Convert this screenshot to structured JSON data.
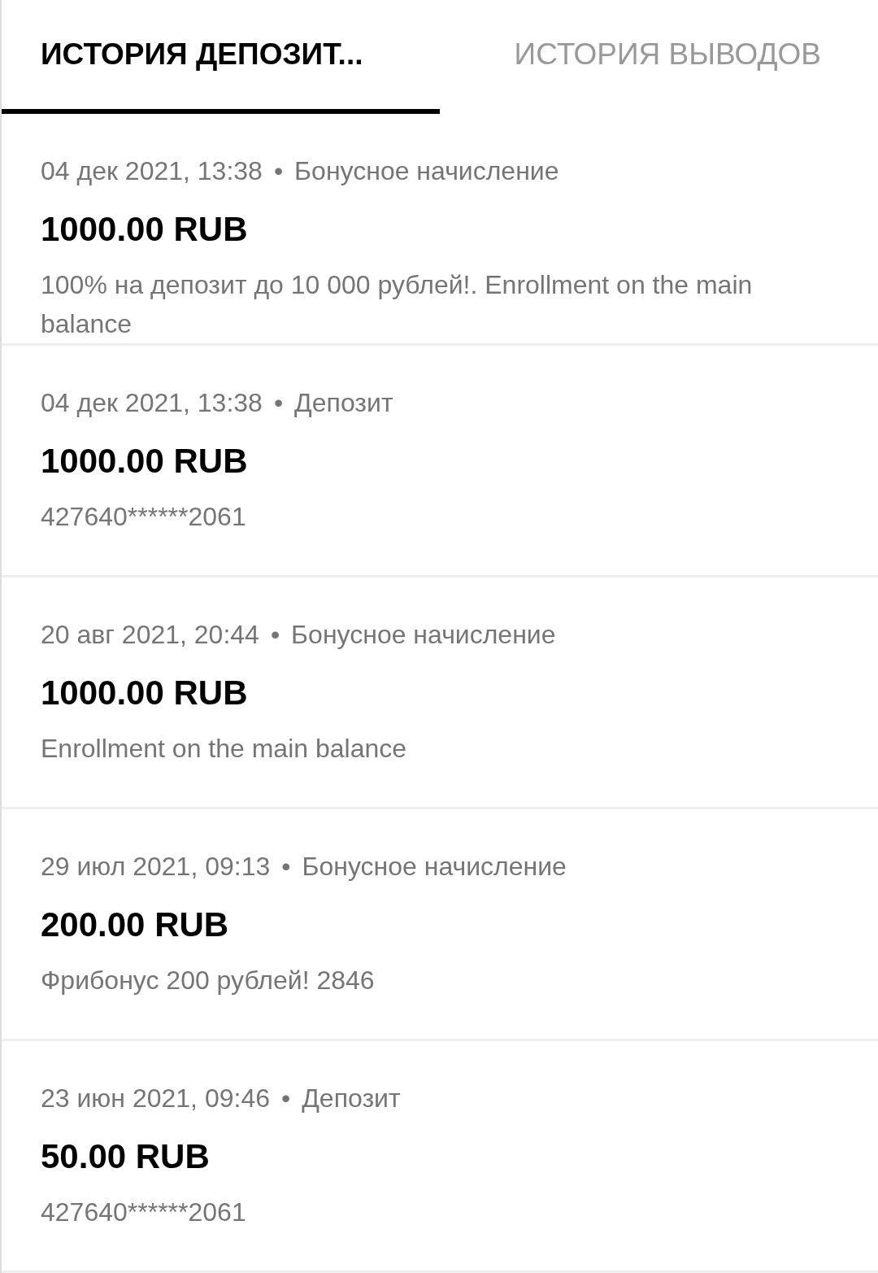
{
  "tabs": [
    {
      "label": "ИСТОРИЯ ДЕПОЗИТ...",
      "selected": true
    },
    {
      "label": "ИСТОРИЯ ВЫВОДОВ",
      "selected": false
    }
  ],
  "transactions": [
    {
      "date": "04 дек 2021, 13:38",
      "separator": "•",
      "type": "Бонусное начисление",
      "amount": "1000.00 RUB",
      "description": "100% на депозит до 10 000 рублей!. Enrollment on the main balance"
    },
    {
      "date": "04 дек 2021, 13:38",
      "separator": "•",
      "type": "Депозит",
      "amount": "1000.00 RUB",
      "description": "427640******2061"
    },
    {
      "date": "20 авг 2021, 20:44",
      "separator": "•",
      "type": "Бонусное начисление",
      "amount": "1000.00 RUB",
      "description": "Enrollment on the main balance"
    },
    {
      "date": "29 июл 2021, 09:13",
      "separator": "•",
      "type": "Бонусное начисление",
      "amount": "200.00 RUB",
      "description": "Фрибонус 200 рублей! 2846"
    },
    {
      "date": "23 июн 2021, 09:46",
      "separator": "•",
      "type": "Депозит",
      "amount": "50.00 RUB",
      "description": "427640******2061"
    }
  ]
}
